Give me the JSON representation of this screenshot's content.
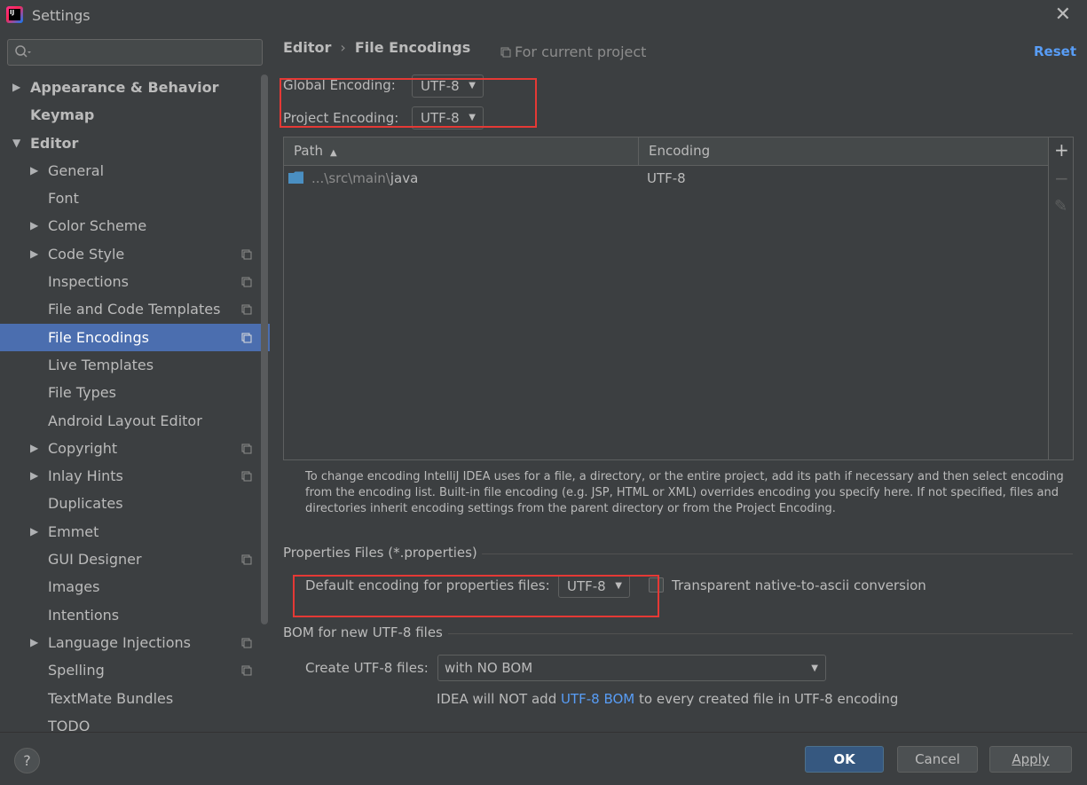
{
  "window": {
    "title": "Settings",
    "close_symbol": "✕"
  },
  "search": {
    "placeholder": ""
  },
  "sidebar": {
    "items": [
      {
        "label": "Appearance & Behavior",
        "level": 0,
        "arrow": "▶",
        "bold": true,
        "project_icon": false
      },
      {
        "label": "Keymap",
        "level": 0,
        "arrow": "",
        "bold": true,
        "project_icon": false
      },
      {
        "label": "Editor",
        "level": 0,
        "arrow": "▼",
        "bold": true,
        "project_icon": false
      },
      {
        "label": "General",
        "level": 1,
        "arrow": "▶",
        "bold": false,
        "project_icon": false
      },
      {
        "label": "Font",
        "level": 1,
        "arrow": "",
        "bold": false,
        "project_icon": false
      },
      {
        "label": "Color Scheme",
        "level": 1,
        "arrow": "▶",
        "bold": false,
        "project_icon": false
      },
      {
        "label": "Code Style",
        "level": 1,
        "arrow": "▶",
        "bold": false,
        "project_icon": true
      },
      {
        "label": "Inspections",
        "level": 1,
        "arrow": "",
        "bold": false,
        "project_icon": true
      },
      {
        "label": "File and Code Templates",
        "level": 1,
        "arrow": "",
        "bold": false,
        "project_icon": true
      },
      {
        "label": "File Encodings",
        "level": 1,
        "arrow": "",
        "bold": false,
        "project_icon": true,
        "selected": true
      },
      {
        "label": "Live Templates",
        "level": 1,
        "arrow": "",
        "bold": false,
        "project_icon": false
      },
      {
        "label": "File Types",
        "level": 1,
        "arrow": "",
        "bold": false,
        "project_icon": false
      },
      {
        "label": "Android Layout Editor",
        "level": 1,
        "arrow": "",
        "bold": false,
        "project_icon": false
      },
      {
        "label": "Copyright",
        "level": 1,
        "arrow": "▶",
        "bold": false,
        "project_icon": true
      },
      {
        "label": "Inlay Hints",
        "level": 1,
        "arrow": "▶",
        "bold": false,
        "project_icon": true
      },
      {
        "label": "Duplicates",
        "level": 1,
        "arrow": "",
        "bold": false,
        "project_icon": false
      },
      {
        "label": "Emmet",
        "level": 1,
        "arrow": "▶",
        "bold": false,
        "project_icon": false
      },
      {
        "label": "GUI Designer",
        "level": 1,
        "arrow": "",
        "bold": false,
        "project_icon": true
      },
      {
        "label": "Images",
        "level": 1,
        "arrow": "",
        "bold": false,
        "project_icon": false
      },
      {
        "label": "Intentions",
        "level": 1,
        "arrow": "",
        "bold": false,
        "project_icon": false
      },
      {
        "label": "Language Injections",
        "level": 1,
        "arrow": "▶",
        "bold": false,
        "project_icon": true
      },
      {
        "label": "Spelling",
        "level": 1,
        "arrow": "",
        "bold": false,
        "project_icon": true
      },
      {
        "label": "TextMate Bundles",
        "level": 1,
        "arrow": "",
        "bold": false,
        "project_icon": false
      },
      {
        "label": "TODO",
        "level": 1,
        "arrow": "",
        "bold": false,
        "project_icon": false
      }
    ]
  },
  "header": {
    "breadcrumb_parent": "Editor",
    "breadcrumb_sep": "›",
    "breadcrumb_current": "File Encodings",
    "scope_note": "For current project",
    "reset_label": "Reset"
  },
  "encodings": {
    "global_label": "Global Encoding:",
    "global_value": "UTF-8",
    "project_label": "Project Encoding:",
    "project_value": "UTF-8"
  },
  "table": {
    "columns": [
      "Path",
      "Encoding"
    ],
    "sort_symbol": "▲",
    "rows": [
      {
        "path_prefix": "...\\src\\main\\",
        "path_tail": "java",
        "encoding": "UTF-8"
      }
    ],
    "tools": [
      "+",
      "−",
      "✎"
    ]
  },
  "help_text": "To change encoding IntelliJ IDEA uses for a file, a directory, or the entire project, add its path if necessary and then select encoding from the encoding list. Built-in file encoding (e.g. JSP, HTML or XML) overrides encoding you specify here. If not specified, files and directories inherit encoding settings from the parent directory or from the Project Encoding.",
  "properties": {
    "section_title": "Properties Files (*.properties)",
    "default_label": "Default encoding for properties files:",
    "default_value": "UTF-8",
    "transparent_label": "Transparent native-to-ascii conversion",
    "transparent_checked": false
  },
  "bom": {
    "section_title": "BOM for new UTF-8 files",
    "create_label": "Create UTF-8 files:",
    "create_value": "with NO BOM",
    "note_prefix": "IDEA will NOT add ",
    "note_link": "UTF-8 BOM",
    "note_suffix": " to every created file in UTF-8 encoding"
  },
  "footer": {
    "help_label": "?",
    "ok_label": "OK",
    "cancel_label": "Cancel",
    "apply_label": "Apply"
  },
  "colors": {
    "background": "#3c3f41",
    "selection": "#4b6eaf",
    "link": "#589df6",
    "highlight_box": "#e53935",
    "primary_button": "#365880",
    "folder": "#4a8fc2"
  }
}
